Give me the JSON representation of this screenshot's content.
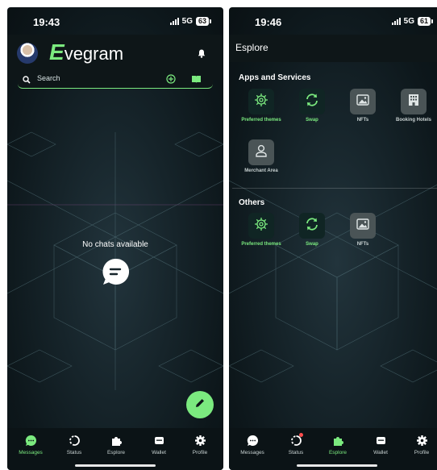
{
  "left": {
    "status": {
      "time": "19:43",
      "network": "5G",
      "battery": "63"
    },
    "brand": {
      "initial": "E",
      "rest": "vegram"
    },
    "search": {
      "placeholder": "Search"
    },
    "empty_state": {
      "text": "No chats available"
    }
  },
  "right": {
    "status": {
      "time": "19:46",
      "network": "5G",
      "battery": "61"
    },
    "title": "Esplore",
    "sections": [
      {
        "title": "Apps and Services",
        "items": [
          "Preferred themes",
          "Swap",
          "NFTs",
          "Booking Hotels",
          "Merchant Area"
        ]
      },
      {
        "title": "Others",
        "items": [
          "Preferred themes",
          "Swap",
          "NFTs"
        ]
      }
    ]
  },
  "nav": {
    "items": [
      {
        "label": "Messages",
        "icon": "messages-icon"
      },
      {
        "label": "Status",
        "icon": "status-icon"
      },
      {
        "label": "Esplore",
        "icon": "puzzle-icon"
      },
      {
        "label": "Wallet",
        "icon": "wallet-icon"
      },
      {
        "label": "Profile",
        "icon": "gear-icon"
      }
    ]
  },
  "colors": {
    "accent": "#7bea7f",
    "background": "#0d171b",
    "badge": "#ff4d4d"
  }
}
